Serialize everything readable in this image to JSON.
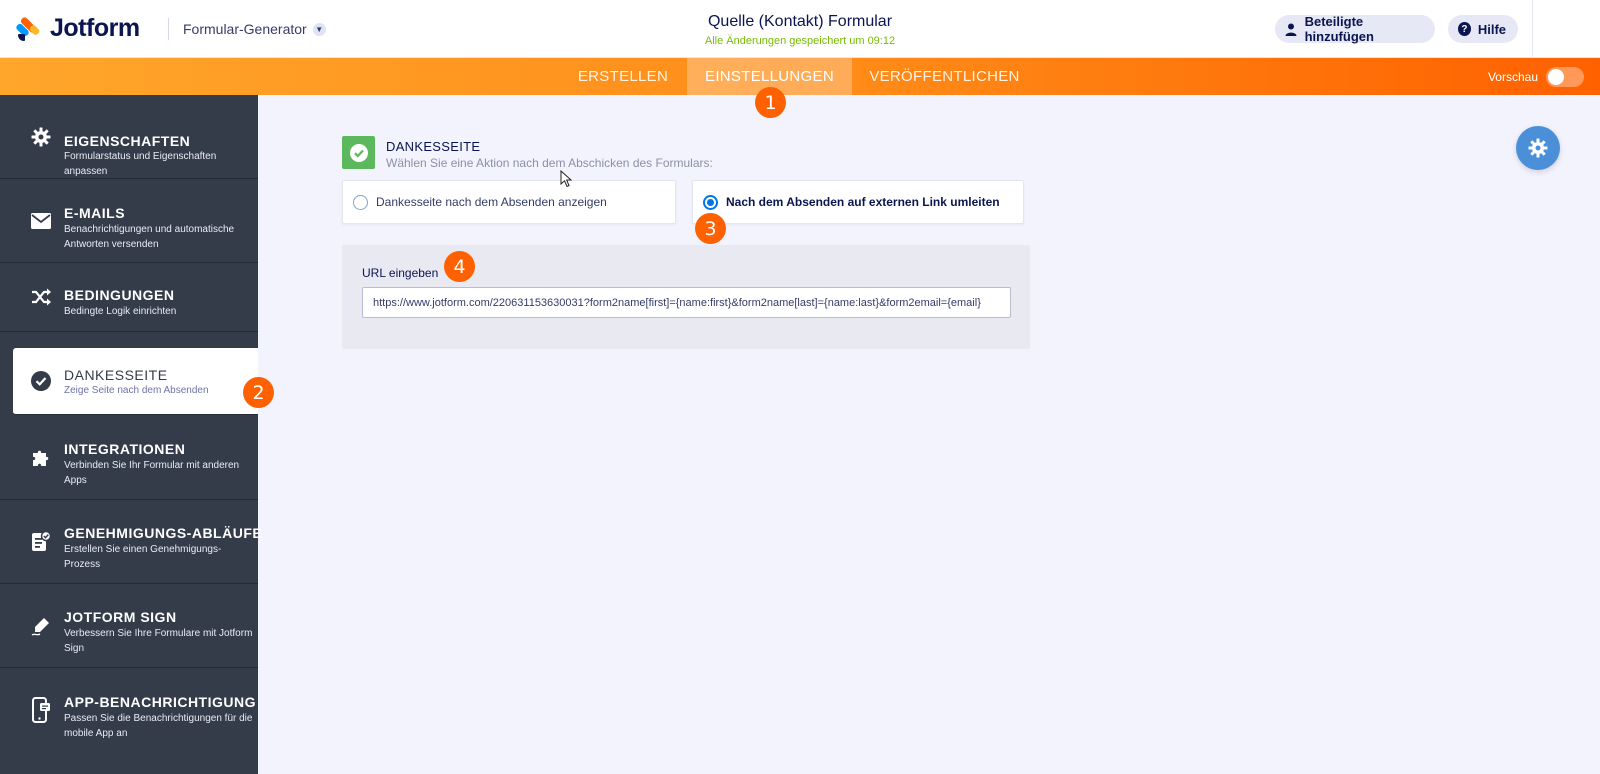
{
  "header": {
    "logo_text": "Jotform",
    "builder_label": "Formular-Generator",
    "form_title": "Quelle (Kontakt) Formular",
    "saved_status": "Alle Änderungen gespeichert um 09:12",
    "add_participants_label": "Beteiligte hinzufügen",
    "help_label": "Hilfe"
  },
  "nav": {
    "tabs": [
      {
        "label": "ERSTELLEN"
      },
      {
        "label": "EINSTELLUNGEN"
      },
      {
        "label": "VERÖFFENTLICHEN"
      }
    ],
    "preview_label": "Vorschau",
    "accent_color": "#ff6100"
  },
  "sidebar": {
    "items": [
      {
        "title": "EIGENSCHAFTEN",
        "desc": "Formularstatus und Eigenschaften anpassen",
        "icon": "gear-icon"
      },
      {
        "title": "E-MAILS",
        "desc": "Benachrichtigungen und automatische Antworten versenden",
        "icon": "envelope-icon"
      },
      {
        "title": "BEDINGUNGEN",
        "desc": "Bedingte Logik einrichten",
        "icon": "shuffle-icon"
      },
      {
        "title": "DANKESSEITE",
        "desc": "Zeige Seite nach dem Absenden",
        "icon": "check-circle-icon"
      },
      {
        "title": "INTEGRATIONEN",
        "desc": "Verbinden Sie Ihr Formular mit anderen Apps",
        "icon": "puzzle-icon"
      },
      {
        "title": "GENEHMIGUNGS-ABLÄUFE",
        "desc": "Erstellen Sie einen Genehmigungs-Prozess",
        "icon": "approval-icon"
      },
      {
        "title": "JOTFORM SIGN",
        "desc": "Verbessern Sie Ihre Formulare mit Jotform Sign",
        "icon": "pen-icon"
      },
      {
        "title": "APP-BENACHRICHTIGUNG",
        "desc": "Passen Sie die Benachrichtigungen für die mobile App an",
        "icon": "phone-icon"
      }
    ]
  },
  "main": {
    "section_title": "DANKESSEITE",
    "section_subtitle": "Wählen Sie eine Aktion nach dem Abschicken des Formulars:",
    "options": [
      {
        "label": "Dankesseite nach dem Absenden anzeigen",
        "checked": false
      },
      {
        "label": "Nach dem Absenden auf externen Link umleiten",
        "checked": true
      }
    ],
    "url_label": "URL eingeben",
    "url_value": "https://www.jotform.com/220631153630031?form2name[first]={name:first}&form2name[last]={name:last}&form2email={email}"
  },
  "badges": [
    "1",
    "2",
    "3",
    "4"
  ]
}
